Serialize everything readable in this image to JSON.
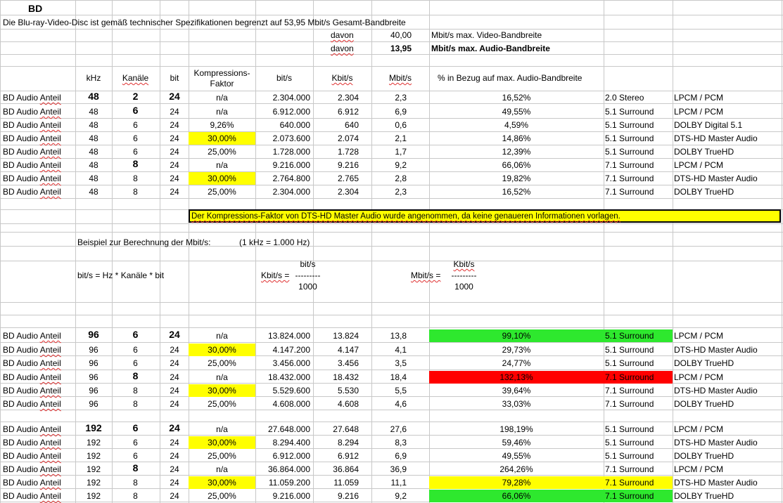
{
  "colors": {
    "gridline": "#c8c8c8",
    "highlight_yellow": "#ffff00",
    "highlight_green": "#2ee82e",
    "highlight_red": "#ff0000",
    "note_border": "#000000"
  },
  "header": {
    "title": "BD",
    "description": "Die Blu-ray-Video-Disc ist gemäß technischer Spezifikationen begrenzt auf 53,95 Mbit/s Gesamt-Bandbreite",
    "davon_label": "davon",
    "video_value": "40,00",
    "video_text": "Mbit/s max. Video-Bandbreite",
    "audio_value": "13,95",
    "audio_text": "Mbit/s max. Audio-Bandbreite"
  },
  "columns": {
    "khz": "kHz",
    "kanaele": "Kanäle",
    "bit": "bit",
    "kompression_1": "Kompressions-",
    "kompression_2": "Faktor",
    "bits": "bit/s",
    "kbits": "Kbit/s",
    "mbits": "Mbit/s",
    "percent": "% in Bezug auf max. Audio-Bandbreite"
  },
  "rows_48": [
    {
      "label": "BD Audio Anteil",
      "khz": "48",
      "ch": "2",
      "bit": "24",
      "comp": "n/a",
      "bits": "2.304.000",
      "kbits": "2.304",
      "mbits": "2,3",
      "pct": "16,52%",
      "mode": "2.0 Stereo",
      "codec": "LPCM / PCM",
      "emph": true,
      "comp_hl": "",
      "pct_hl": ""
    },
    {
      "label": "BD Audio Anteil",
      "khz": "48",
      "ch": "6",
      "bit": "24",
      "comp": "n/a",
      "bits": "6.912.000",
      "kbits": "6.912",
      "mbits": "6,9",
      "pct": "49,55%",
      "mode": "5.1 Surround",
      "codec": "LPCM / PCM",
      "emph": "ch",
      "comp_hl": "",
      "pct_hl": ""
    },
    {
      "label": "BD Audio Anteil",
      "khz": "48",
      "ch": "6",
      "bit": "24",
      "comp": "9,26%",
      "bits": "640.000",
      "kbits": "640",
      "mbits": "0,6",
      "pct": "4,59%",
      "mode": "5.1 Surround",
      "codec": "DOLBY Digital 5.1",
      "emph": false,
      "comp_hl": "",
      "pct_hl": ""
    },
    {
      "label": "BD Audio Anteil",
      "khz": "48",
      "ch": "6",
      "bit": "24",
      "comp": "30,00%",
      "bits": "2.073.600",
      "kbits": "2.074",
      "mbits": "2,1",
      "pct": "14,86%",
      "mode": "5.1 Surround",
      "codec": "DTS-HD Master Audio",
      "emph": false,
      "comp_hl": "yellow",
      "pct_hl": ""
    },
    {
      "label": "BD Audio Anteil",
      "khz": "48",
      "ch": "6",
      "bit": "24",
      "comp": "25,00%",
      "bits": "1.728.000",
      "kbits": "1.728",
      "mbits": "1,7",
      "pct": "12,39%",
      "mode": "5.1 Surround",
      "codec": "DOLBY TrueHD",
      "emph": false,
      "comp_hl": "",
      "pct_hl": ""
    },
    {
      "label": "BD Audio Anteil",
      "khz": "48",
      "ch": "8",
      "bit": "24",
      "comp": "n/a",
      "bits": "9.216.000",
      "kbits": "9.216",
      "mbits": "9,2",
      "pct": "66,06%",
      "mode": "7.1 Surround",
      "codec": "LPCM / PCM",
      "emph": "ch",
      "comp_hl": "",
      "pct_hl": ""
    },
    {
      "label": "BD Audio Anteil",
      "khz": "48",
      "ch": "8",
      "bit": "24",
      "comp": "30,00%",
      "bits": "2.764.800",
      "kbits": "2.765",
      "mbits": "2,8",
      "pct": "19,82%",
      "mode": "7.1 Surround",
      "codec": "DTS-HD Master Audio",
      "emph": false,
      "comp_hl": "yellow",
      "pct_hl": ""
    },
    {
      "label": "BD Audio Anteil",
      "khz": "48",
      "ch": "8",
      "bit": "24",
      "comp": "25,00%",
      "bits": "2.304.000",
      "kbits": "2.304",
      "mbits": "2,3",
      "pct": "16,52%",
      "mode": "7.1 Surround",
      "codec": "DOLBY TrueHD",
      "emph": false,
      "comp_hl": "",
      "pct_hl": ""
    }
  ],
  "note": "Der Kompressions-Faktor von DTS-HD Master Audio wurde angenommen, da keine genaueren Informationen vorlagen.",
  "example": {
    "title": "Beispiel zur Berechnung der Mbit/s:",
    "khz_note": "(1 kHz = 1.000 Hz)",
    "formula_bits": "bit/s = Hz * Kanäle * bit",
    "kbits_lhs": "Kbit/s =",
    "kbits_num": "bit/s",
    "kbits_line": "---------",
    "kbits_den": "1000",
    "mbits_lhs": "Mbit/s =",
    "mbits_num": "Kbit/s",
    "mbits_line": "---------",
    "mbits_den": "1000"
  },
  "rows_96": [
    {
      "label": "BD Audio Anteil",
      "khz": "96",
      "ch": "6",
      "bit": "24",
      "comp": "n/a",
      "bits": "13.824.000",
      "kbits": "13.824",
      "mbits": "13,8",
      "pct": "99,10%",
      "mode": "5.1 Surround",
      "codec": "LPCM / PCM",
      "emph": true,
      "comp_hl": "",
      "pct_hl": "green"
    },
    {
      "label": "BD Audio Anteil",
      "khz": "96",
      "ch": "6",
      "bit": "24",
      "comp": "30,00%",
      "bits": "4.147.200",
      "kbits": "4.147",
      "mbits": "4,1",
      "pct": "29,73%",
      "mode": "5.1 Surround",
      "codec": "DTS-HD Master Audio",
      "emph": false,
      "comp_hl": "yellow",
      "pct_hl": ""
    },
    {
      "label": "BD Audio Anteil",
      "khz": "96",
      "ch": "6",
      "bit": "24",
      "comp": "25,00%",
      "bits": "3.456.000",
      "kbits": "3.456",
      "mbits": "3,5",
      "pct": "24,77%",
      "mode": "5.1 Surround",
      "codec": "DOLBY TrueHD",
      "emph": false,
      "comp_hl": "",
      "pct_hl": ""
    },
    {
      "label": "BD Audio Anteil",
      "khz": "96",
      "ch": "8",
      "bit": "24",
      "comp": "n/a",
      "bits": "18.432.000",
      "kbits": "18.432",
      "mbits": "18,4",
      "pct": "132,13%",
      "mode": "7.1 Surround",
      "codec": "LPCM / PCM",
      "emph": "ch",
      "comp_hl": "",
      "pct_hl": "red"
    },
    {
      "label": "BD Audio Anteil",
      "khz": "96",
      "ch": "8",
      "bit": "24",
      "comp": "30,00%",
      "bits": "5.529.600",
      "kbits": "5.530",
      "mbits": "5,5",
      "pct": "39,64%",
      "mode": "7.1 Surround",
      "codec": "DTS-HD Master Audio",
      "emph": false,
      "comp_hl": "yellow",
      "pct_hl": ""
    },
    {
      "label": "BD Audio Anteil",
      "khz": "96",
      "ch": "8",
      "bit": "24",
      "comp": "25,00%",
      "bits": "4.608.000",
      "kbits": "4.608",
      "mbits": "4,6",
      "pct": "33,03%",
      "mode": "7.1 Surround",
      "codec": "DOLBY TrueHD",
      "emph": false,
      "comp_hl": "",
      "pct_hl": ""
    }
  ],
  "rows_192": [
    {
      "label": "BD Audio Anteil",
      "khz": "192",
      "ch": "6",
      "bit": "24",
      "comp": "n/a",
      "bits": "27.648.000",
      "kbits": "27.648",
      "mbits": "27,6",
      "pct": "198,19%",
      "mode": "5.1 Surround",
      "codec": "LPCM / PCM",
      "emph": true,
      "comp_hl": "",
      "pct_hl": ""
    },
    {
      "label": "BD Audio Anteil",
      "khz": "192",
      "ch": "6",
      "bit": "24",
      "comp": "30,00%",
      "bits": "8.294.400",
      "kbits": "8.294",
      "mbits": "8,3",
      "pct": "59,46%",
      "mode": "5.1 Surround",
      "codec": "DTS-HD Master Audio",
      "emph": false,
      "comp_hl": "yellow",
      "pct_hl": ""
    },
    {
      "label": "BD Audio Anteil",
      "khz": "192",
      "ch": "6",
      "bit": "24",
      "comp": "25,00%",
      "bits": "6.912.000",
      "kbits": "6.912",
      "mbits": "6,9",
      "pct": "49,55%",
      "mode": "5.1 Surround",
      "codec": "DOLBY TrueHD",
      "emph": false,
      "comp_hl": "",
      "pct_hl": ""
    },
    {
      "label": "BD Audio Anteil",
      "khz": "192",
      "ch": "8",
      "bit": "24",
      "comp": "n/a",
      "bits": "36.864.000",
      "kbits": "36.864",
      "mbits": "36,9",
      "pct": "264,26%",
      "mode": "7.1 Surround",
      "codec": "LPCM / PCM",
      "emph": "ch",
      "comp_hl": "",
      "pct_hl": ""
    },
    {
      "label": "BD Audio Anteil",
      "khz": "192",
      "ch": "8",
      "bit": "24",
      "comp": "30,00%",
      "bits": "11.059.200",
      "kbits": "11.059",
      "mbits": "11,1",
      "pct": "79,28%",
      "mode": "7.1 Surround",
      "codec": "DTS-HD Master Audio",
      "emph": false,
      "comp_hl": "yellow",
      "pct_hl": "yellow"
    },
    {
      "label": "BD Audio Anteil",
      "khz": "192",
      "ch": "8",
      "bit": "24",
      "comp": "25,00%",
      "bits": "9.216.000",
      "kbits": "9.216",
      "mbits": "9,2",
      "pct": "66,06%",
      "mode": "7.1 Surround",
      "codec": "DOLBY TrueHD",
      "emph": false,
      "comp_hl": "",
      "pct_hl": "green"
    }
  ]
}
